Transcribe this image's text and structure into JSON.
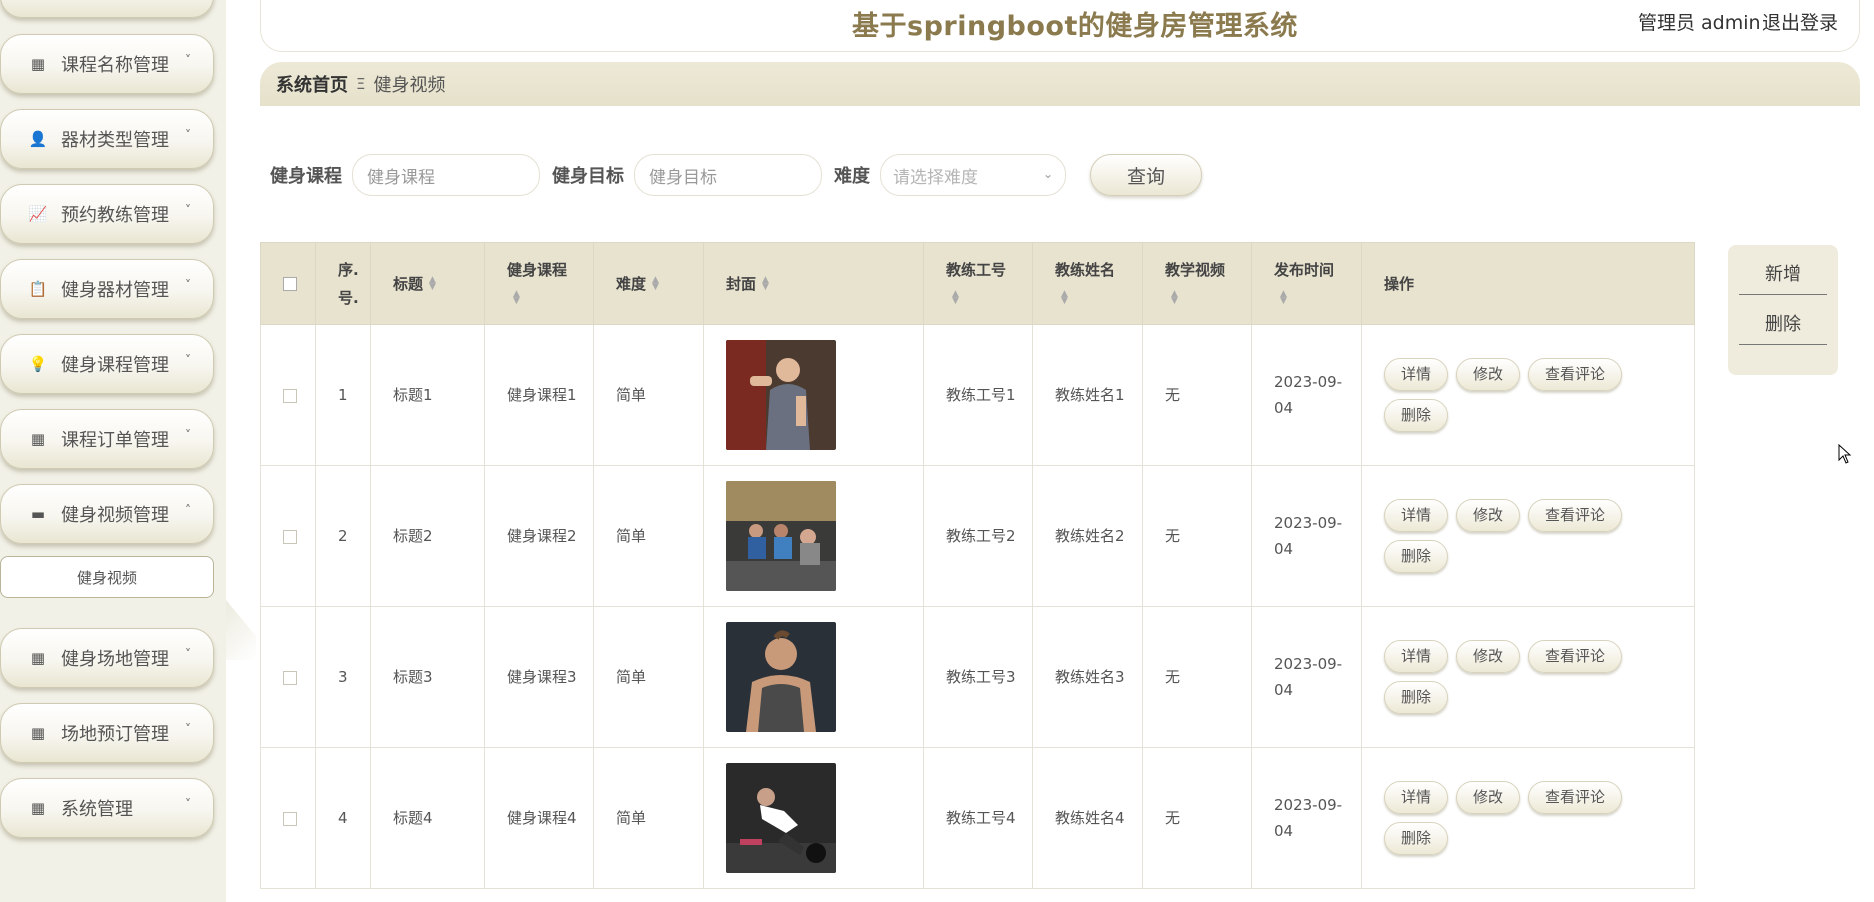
{
  "header": {
    "title": "基于springboot的健身房管理系统",
    "admin_label": "管理员 admin",
    "logout_label": "退出登录"
  },
  "breadcrumb": {
    "home": "系统首页",
    "separator": "Ξ",
    "current": "健身视频"
  },
  "sidebar": {
    "items": [
      {
        "label": "课程名称管理",
        "icon": "grid-icon",
        "chevron": "˅"
      },
      {
        "label": "器材类型管理",
        "icon": "user-icon",
        "chevron": "˅"
      },
      {
        "label": "预约教练管理",
        "icon": "chart-icon",
        "chevron": "˅"
      },
      {
        "label": "健身器材管理",
        "icon": "clipboard-icon",
        "chevron": "˅"
      },
      {
        "label": "健身课程管理",
        "icon": "bulb-icon",
        "chevron": "˅"
      },
      {
        "label": "课程订单管理",
        "icon": "grid-icon",
        "chevron": "˅"
      },
      {
        "label": "健身视频管理",
        "icon": "box-icon",
        "chevron": "˄"
      },
      {
        "label": "健身场地管理",
        "icon": "grid-icon",
        "chevron": "˅"
      },
      {
        "label": "场地预订管理",
        "icon": "grid-icon",
        "chevron": "˅"
      },
      {
        "label": "系统管理",
        "icon": "grid-icon",
        "chevron": "˅"
      }
    ],
    "subitem": "健身视频"
  },
  "search": {
    "course_label": "健身课程",
    "course_placeholder": "健身课程",
    "goal_label": "健身目标",
    "goal_placeholder": "健身目标",
    "difficulty_label": "难度",
    "difficulty_placeholder": "请选择难度",
    "query_button": "查询"
  },
  "actions": {
    "add": "新增",
    "delete": "删除"
  },
  "table": {
    "headers": {
      "index": "序.号.",
      "title": "标题",
      "course": "健身课程",
      "difficulty": "难度",
      "cover": "封面",
      "coach_id": "教练工号",
      "coach_name": "教练姓名",
      "video": "教学视频",
      "publish_time": "发布时间",
      "ops": "操作"
    },
    "op_labels": {
      "detail": "详情",
      "edit": "修改",
      "comments": "查看评论",
      "delete": "删除"
    },
    "rows": [
      {
        "index": "1",
        "title": "标题1",
        "course": "健身课程1",
        "difficulty": "简单",
        "coach_id": "教练工号1",
        "coach_name": "教练姓名1",
        "video": "无",
        "publish_time": "2023-09-04"
      },
      {
        "index": "2",
        "title": "标题2",
        "course": "健身课程2",
        "difficulty": "简单",
        "coach_id": "教练工号2",
        "coach_name": "教练姓名2",
        "video": "无",
        "publish_time": "2023-09-04"
      },
      {
        "index": "3",
        "title": "标题3",
        "course": "健身课程3",
        "difficulty": "简单",
        "coach_id": "教练工号3",
        "coach_name": "教练姓名3",
        "video": "无",
        "publish_time": "2023-09-04"
      },
      {
        "index": "4",
        "title": "标题4",
        "course": "健身课程4",
        "difficulty": "简单",
        "coach_id": "教练工号4",
        "coach_name": "教练姓名4",
        "video": "无",
        "publish_time": "2023-09-04"
      }
    ]
  },
  "colors": {
    "accent": "#8a7a4e",
    "header_bg": "#e8e3cf",
    "sidebar_bg": "#f2f1e7"
  }
}
